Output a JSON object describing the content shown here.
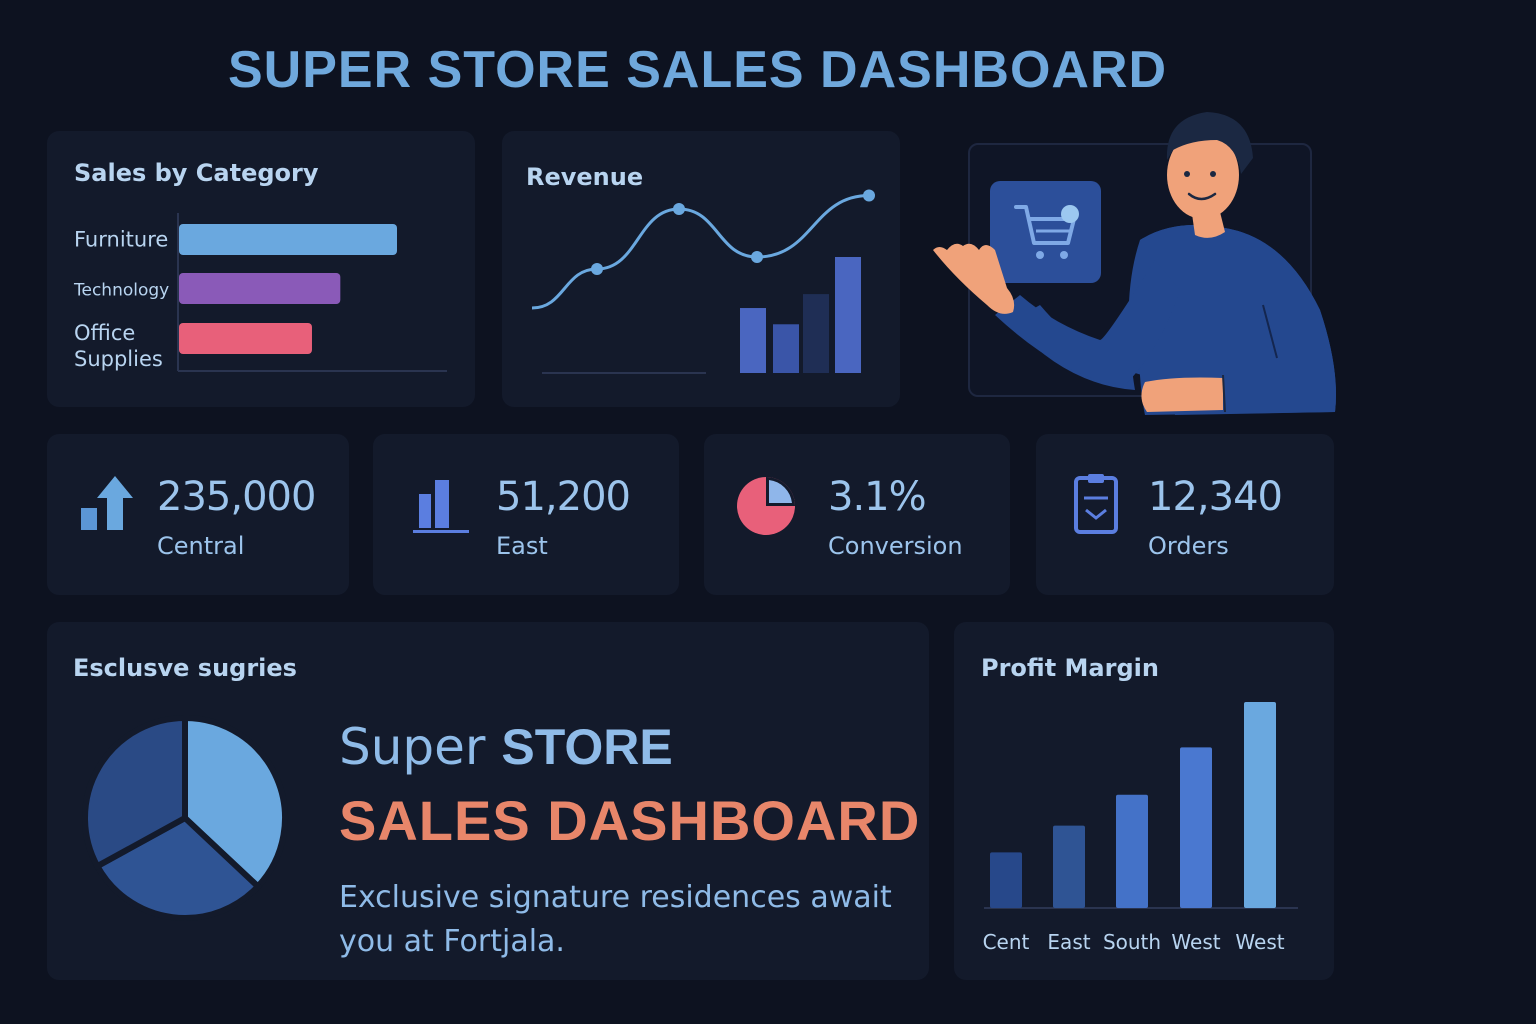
{
  "title": "SUPER STORE SALES DASHBOARD",
  "sales_by_category": {
    "title": "Sales by Category",
    "chart_data": {
      "type": "bar",
      "orientation": "horizontal",
      "categories": [
        "Furniture",
        "Technology",
        "Office Supplies"
      ],
      "values": [
        100,
        74,
        61
      ],
      "colors": [
        "#6aa8df",
        "#8a5ab8",
        "#e8607a"
      ],
      "grid": false
    }
  },
  "revenue": {
    "title": "Revenue",
    "chart_data": {
      "type": "line",
      "series": [
        {
          "values": [
            22,
            48,
            88,
            56,
            97
          ],
          "color": "#6aa8df"
        }
      ],
      "bars": [
        {
          "values": [
            56,
            42,
            68,
            100
          ],
          "colors": [
            "#4a66c0",
            "#3a55a8",
            "#1f2e55",
            "#4a66c0"
          ]
        }
      ],
      "grid": false
    }
  },
  "promo_panel": {
    "icon": "shopping-cart-icon",
    "figure": "presenter-illustration"
  },
  "stats": [
    {
      "value": "235,000",
      "label": "Central",
      "icon": "arrow-up-bar-icon",
      "color": "#6aa8df"
    },
    {
      "value": "51,200",
      "label": "East",
      "icon": "bar-chart-icon",
      "color": "#5b7ee0"
    },
    {
      "value": "3.1%",
      "label": "Conversion",
      "icon": "pie-chart-icon",
      "color": "#e8607a"
    },
    {
      "value": "12,340",
      "label": "Orders",
      "icon": "clipboard-icon",
      "color": "#5b7ee0"
    }
  ],
  "exclusive": {
    "title": "Esclusve sugries",
    "chart_data": {
      "type": "pie",
      "values": [
        37,
        30,
        33
      ],
      "colors": [
        "#6aa8df",
        "#2f5494",
        "#2a4a85"
      ]
    },
    "headline_word1": "Super",
    "headline_word2": "STORE",
    "headline_line2": "SALES DASHBOARD",
    "body": "Exclusive signature residences await you at Fortjala."
  },
  "profit_margin": {
    "title": "Profit Margin",
    "chart_data": {
      "type": "bar",
      "categories": [
        "Cent",
        "East",
        "South",
        "West",
        "West"
      ],
      "values": [
        27,
        40,
        55,
        78,
        100
      ],
      "colors": [
        "#27488a",
        "#2f5494",
        "#4472c8",
        "#4a78d0",
        "#6aa8df"
      ],
      "grid": false
    }
  }
}
